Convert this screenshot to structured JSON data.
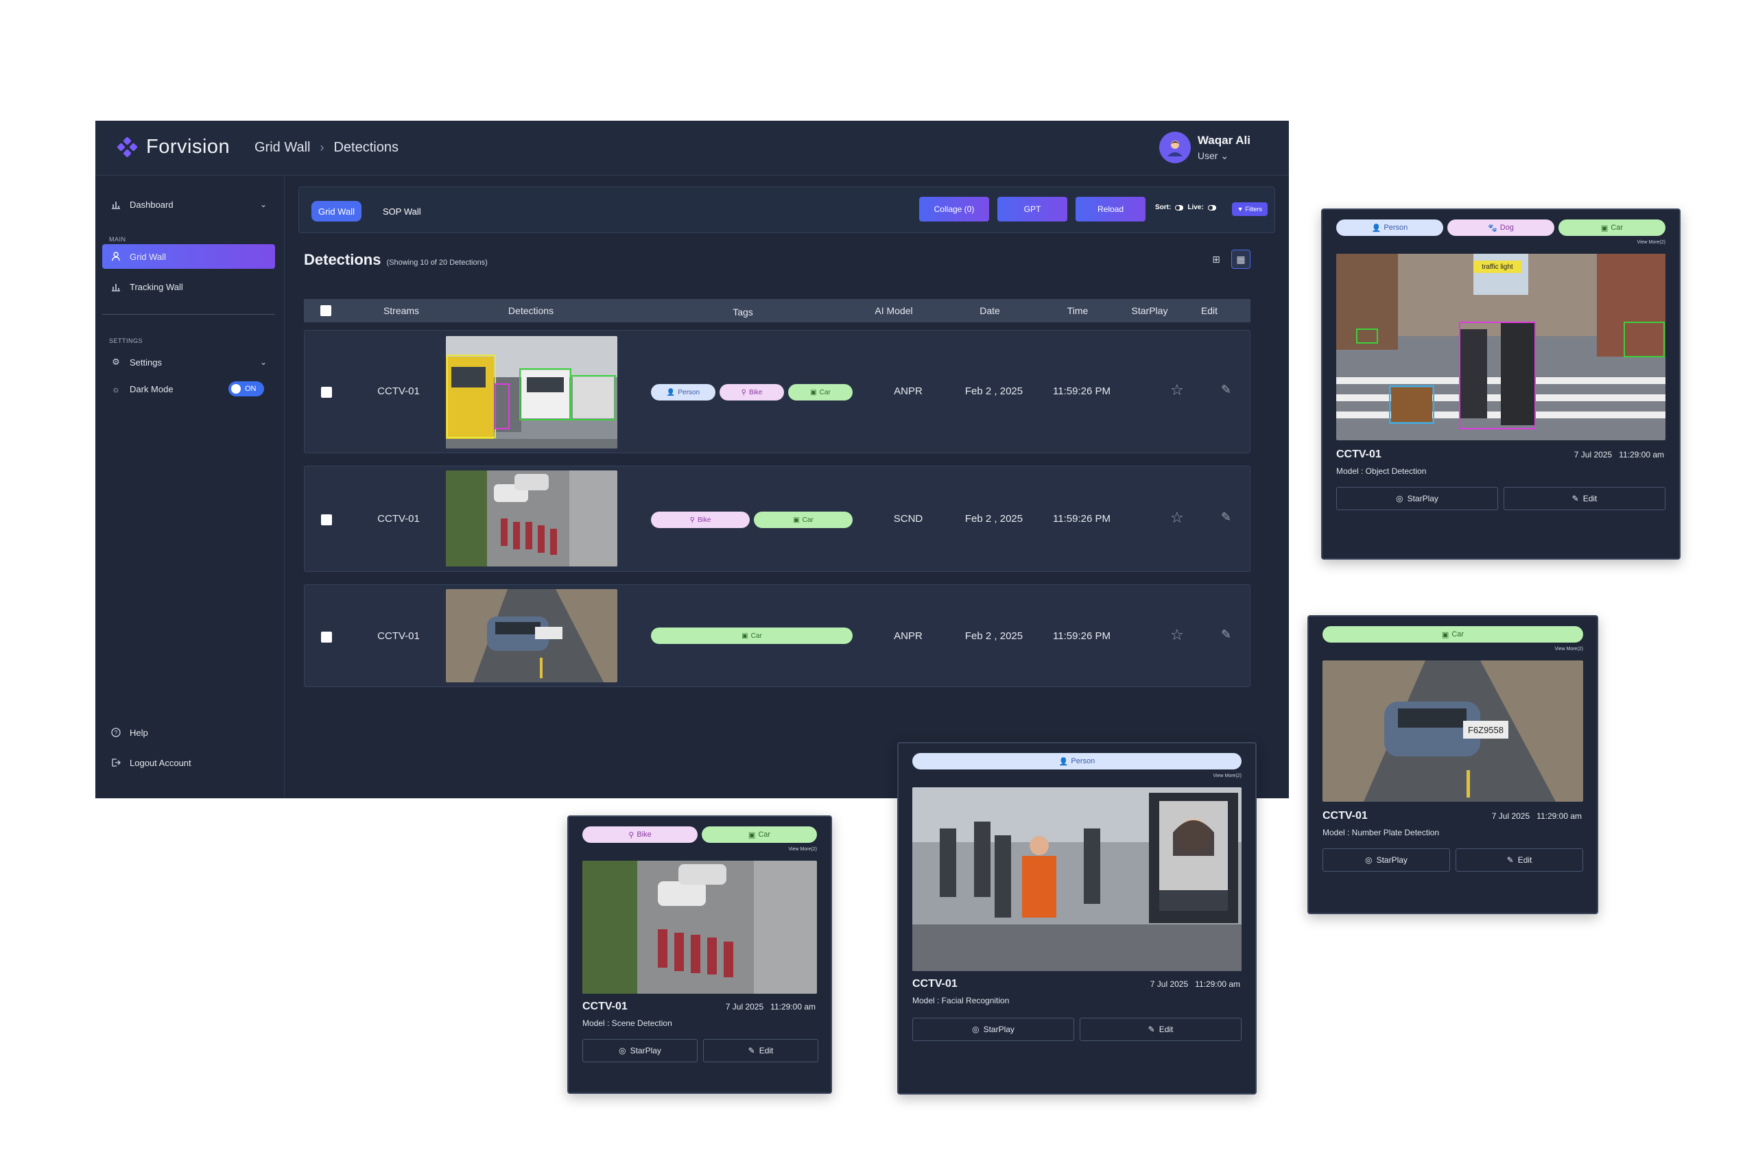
{
  "app": {
    "brand": "Forvision",
    "breadcrumb": [
      "Grid Wall",
      "Detections"
    ],
    "user": {
      "name": "Waqar Ali",
      "role": "User"
    }
  },
  "sidebar": {
    "dashboard": "Dashboard",
    "main_heading": "MAIN",
    "items": [
      {
        "label": "Grid Wall"
      },
      {
        "label": "Tracking Wall"
      }
    ],
    "settings_heading": "SETTINGS",
    "settings": "Settings",
    "dark_mode": "Dark Mode",
    "dark_mode_state": "ON",
    "help": "Help",
    "logout": "Logout Account"
  },
  "toolbar": {
    "tab_grid": "Grid Wall",
    "tab_sop": "SOP Wall",
    "collage": "Collage (0)",
    "gpt": "GPT",
    "reload": "Reload",
    "sort": "Sort:",
    "live": "Live:",
    "filters": "Filters"
  },
  "detections": {
    "title": "Detections",
    "subtitle": "(Showing 10 of 20 Detections)",
    "columns": [
      "Streams",
      "Detections",
      "Tags",
      "AI Model",
      "Date",
      "Time",
      "StarPlay",
      "Edit"
    ],
    "rows": [
      {
        "stream": "CCTV-01",
        "tags": [
          "Person",
          "Bike",
          "Car"
        ],
        "model": "ANPR",
        "date": "Feb 2 , 2025",
        "time": "11:59:26 PM"
      },
      {
        "stream": "CCTV-01",
        "tags": [
          "Bike",
          "Car"
        ],
        "model": "SCND",
        "date": "Feb 2 , 2025",
        "time": "11:59:26 PM"
      },
      {
        "stream": "CCTV-01",
        "tags": [
          "Car"
        ],
        "model": "ANPR",
        "date": "Feb 2 , 2025",
        "time": "11:59:26 PM"
      }
    ]
  },
  "cards": {
    "object": {
      "tags": [
        "Person",
        "Dog",
        "Car"
      ],
      "view_more": "View More(2)",
      "camera": "CCTV-01",
      "date": "7 Jul 2025",
      "time": "11:29:00 am",
      "model": "Model : Object Detection",
      "starplay": "StarPlay",
      "edit": "Edit",
      "overlay": "traffic light"
    },
    "plate": {
      "tags": [
        "Car"
      ],
      "view_more": "View More(2)",
      "camera": "CCTV-01",
      "date": "7 Jul 2025",
      "time": "11:29:00 am",
      "model": "Model : Number Plate Detection",
      "starplay": "StarPlay",
      "edit": "Edit",
      "plate": "F6Z9558"
    },
    "face": {
      "tags": [
        "Person"
      ],
      "view_more": "View More(2)",
      "camera": "CCTV-01",
      "date": "7 Jul 2025",
      "time": "11:29:00 am",
      "model": "Model : Facial Recognition",
      "starplay": "StarPlay",
      "edit": "Edit"
    },
    "scene": {
      "tags": [
        "Bike",
        "Car"
      ],
      "view_more": "View More(2)",
      "camera": "CCTV-01",
      "date": "7 Jul 2025",
      "time": "11:29:00 am",
      "model": "Model : Scene Detection",
      "starplay": "StarPlay",
      "edit": "Edit"
    }
  },
  "icons": {
    "dashboard": "bar-chart-icon",
    "user": "person-icon",
    "tracking": "bar-chart-icon",
    "settings": "gear-icon",
    "dark": "sun-icon",
    "help": "help-circle-icon",
    "logout": "logout-icon",
    "star": "star-icon",
    "edit": "edit-icon",
    "grid": "grid-icon",
    "table": "table-icon"
  },
  "colors": {
    "accent": "#5b6cf5",
    "accent2": "#7b4de8",
    "bg": "#1f2738",
    "person": "#d8e4fb",
    "bike": "#f1d8f6",
    "car": "#b8efb0"
  }
}
